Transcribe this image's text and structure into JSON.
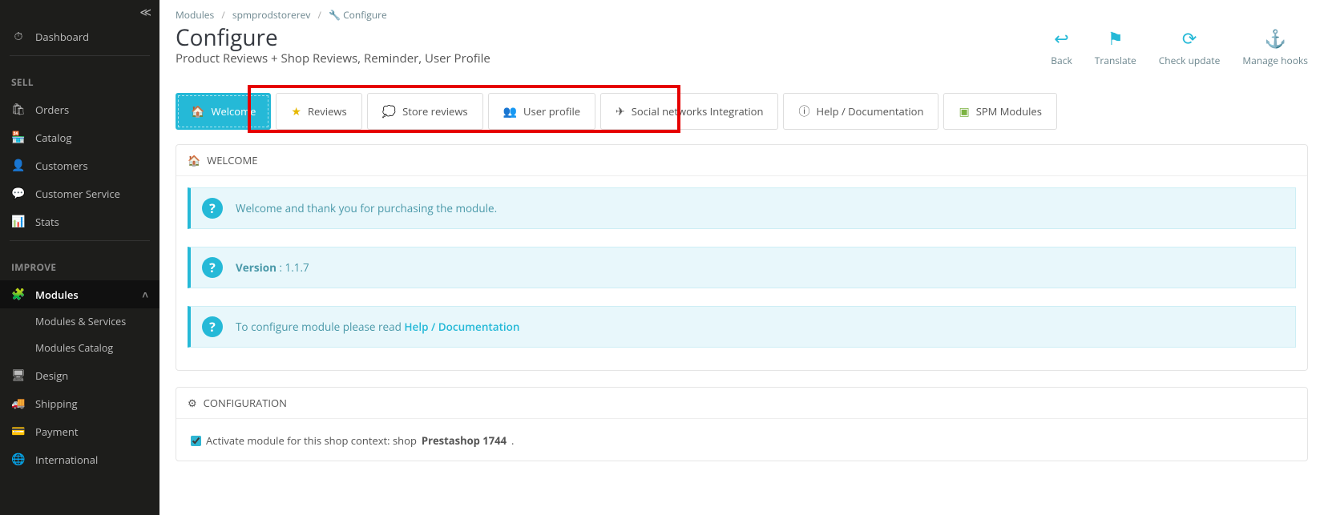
{
  "sidebar": {
    "dashboard": "Dashboard",
    "section_sell": "SELL",
    "orders": "Orders",
    "catalog": "Catalog",
    "customers": "Customers",
    "customer_service": "Customer Service",
    "stats": "Stats",
    "section_improve": "IMPROVE",
    "modules": "Modules",
    "modules_services": "Modules & Services",
    "modules_catalog": "Modules Catalog",
    "design": "Design",
    "shipping": "Shipping",
    "payment": "Payment",
    "international": "International"
  },
  "breadcrumb": {
    "modules": "Modules",
    "slug": "spmprodstorerev",
    "configure": "Configure"
  },
  "page": {
    "title": "Configure",
    "subtitle": "Product Reviews + Shop Reviews, Reminder, User Profile"
  },
  "actions": {
    "back": "Back",
    "translate": "Translate",
    "check": "Check update",
    "hooks": "Manage hooks"
  },
  "tabs": {
    "welcome": "Welcome",
    "reviews": "Reviews",
    "store": "Store reviews",
    "profile": "User profile",
    "social": "Social networks Integration",
    "help": "Help / Documentation",
    "spm": "SPM Modules"
  },
  "welcome_panel": {
    "heading": "WELCOME",
    "thank_you": "Welcome and thank you for purchasing the module.",
    "version_label": "Version",
    "version_sep": " : ",
    "version_value": "1.1.7",
    "config_text": "To configure module please read ",
    "config_link": "Help / Documentation"
  },
  "config_panel": {
    "heading": "CONFIGURATION",
    "checkbox_pre": "Activate module for this shop context: shop ",
    "checkbox_bold": "Prestashop 1744",
    "checkbox_post": "."
  }
}
